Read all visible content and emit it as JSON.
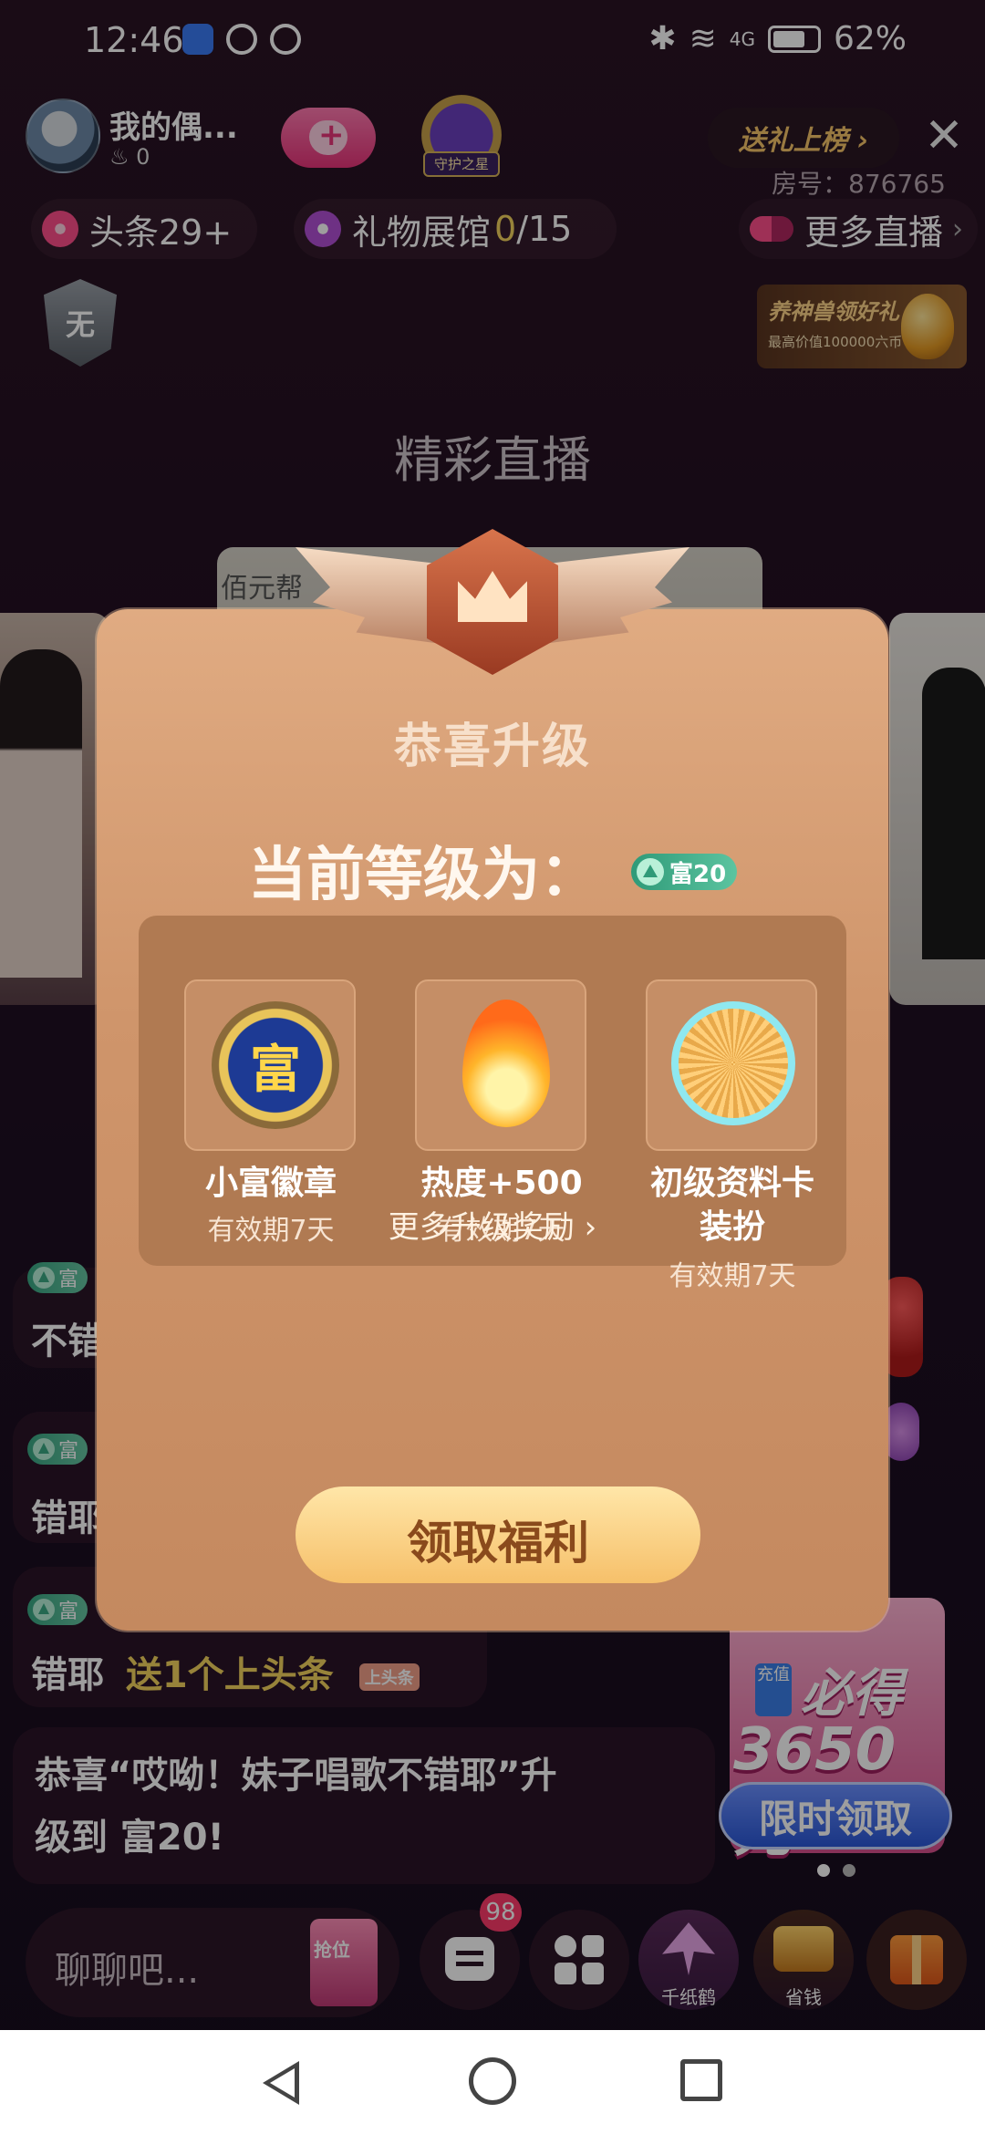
{
  "status_bar": {
    "time": "12:46",
    "battery": "62%",
    "signal": "4G"
  },
  "header": {
    "host_name": "我的偶...",
    "host_fans": "0",
    "guard_label": "守护之星",
    "gift_rank_label": "送礼上榜 ›",
    "close_label": "✕",
    "room_no": "房号：876765"
  },
  "pills": {
    "headline": "头条29+",
    "gallery_label": "礼物展馆",
    "gallery_count": "0",
    "gallery_total": "/15",
    "more_live": "更多直播"
  },
  "rank_badge": "无",
  "promo": {
    "title": "养神兽领好礼",
    "sub": "最高价值100000六币"
  },
  "section_title": "精彩直播",
  "live_mid_caption": "佰元帮",
  "chat": [
    {
      "level": "富",
      "text": "不错"
    },
    {
      "level": "富",
      "text": "错耶"
    },
    {
      "level": "富",
      "text": "错耶",
      "action": "送1个上头条",
      "tag": "上头条"
    },
    {
      "text_line1": "恭喜“哎呦！妹子唱歌不错耶”升",
      "text_line2": "级到 富20!"
    }
  ],
  "charge_promo": {
    "box": "充值",
    "bide": "必得",
    "amount": "3650元",
    "button": "限时领取"
  },
  "bottom_bar": {
    "input_placeholder": "聊聊吧...",
    "seat_label": "抢位",
    "msg_badge": "98",
    "crane_label": "千纸鹤",
    "save_label": "省钱"
  },
  "modal": {
    "title": "恭喜升级",
    "subtitle": "当前等级为：",
    "level_badge": "富20",
    "rewards": [
      {
        "icon": "rich-medal-icon",
        "medal_text": "富",
        "label": "小富徽章",
        "validity": "有效期7天"
      },
      {
        "icon": "flame-icon",
        "label": "热度+500",
        "validity": "有效期7天"
      },
      {
        "icon": "profile-card-frame-icon",
        "label_line1": "初级资料卡",
        "label_line2": "装扮",
        "validity": "有效期7天"
      }
    ],
    "more_rewards": "更多升级奖励 ›",
    "claim_button": "领取福利"
  },
  "colors": {
    "accent_pink": "#e8347a",
    "level_green": "#3aa884",
    "modal_bg": "#cf956b",
    "claim_gold": "#f6c06a"
  }
}
